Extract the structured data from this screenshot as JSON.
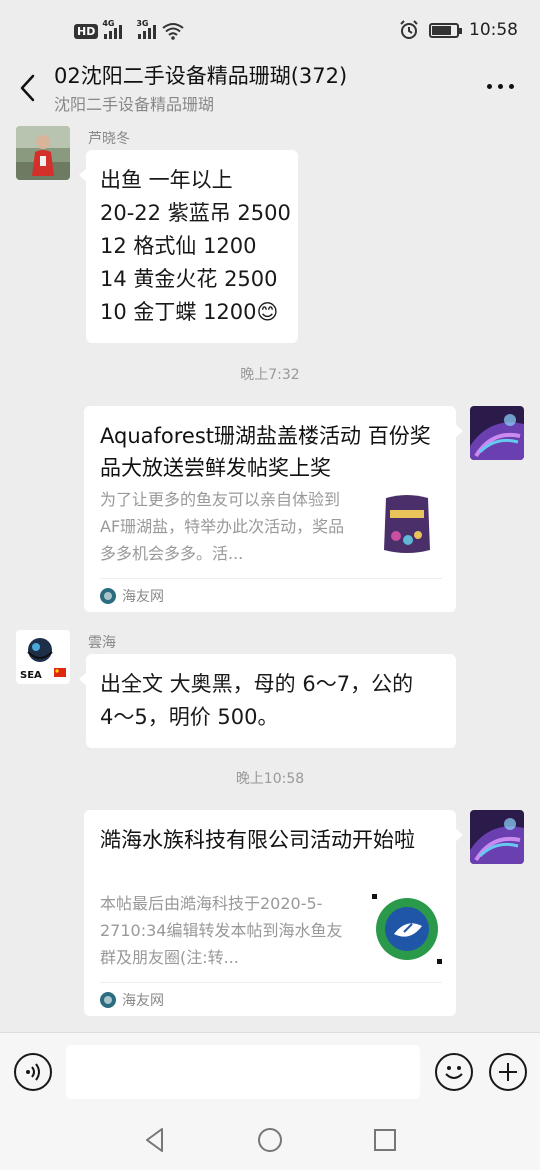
{
  "status_bar": {
    "time": "10:58",
    "hd_label": "HD",
    "sim1_type": "4G",
    "sim2_type": "3G",
    "battery_level": 0.8,
    "icons": [
      "hd-icon",
      "signal-icon",
      "wifi-icon",
      "alarm-icon",
      "battery-icon"
    ]
  },
  "header": {
    "title": "02沈阳二手设备精品珊瑚(372)",
    "subtitle": "沈阳二手设备精品珊瑚"
  },
  "messages": [
    {
      "type": "text",
      "side": "left",
      "sender": "芦晓冬",
      "lines": [
        "出鱼 一年以上",
        "20-22 紫蓝吊 2500",
        "12 格式仙 1200",
        "14 黄金火花 2500",
        "10 金丁蝶 1200😊"
      ]
    },
    {
      "type": "time",
      "text": "晚上7:32"
    },
    {
      "type": "link_card",
      "side": "right",
      "title": "Aquaforest珊湖盐盖楼活动 百份奖品大放送尝鲜发帖奖上奖",
      "description": "为了让更多的鱼友可以亲自体验到AF珊湖盐，特举办此次活动，奖品多多机会多多。活...",
      "source": "海友网"
    },
    {
      "type": "text",
      "side": "left",
      "sender": "雲海",
      "lines": [
        "出全文  大奥黑，母的 6～7，公的",
        "4～5，明价 500。"
      ]
    },
    {
      "type": "time",
      "text": "晚上10:58"
    },
    {
      "type": "link_card",
      "side": "right",
      "title": "澔海水族科技有限公司活动开始啦",
      "description": "本帖最后由澔海科技于2020-5-2710:34编辑转发本帖到海水鱼友群及朋友圈(注:转...",
      "source": "海友网"
    }
  ],
  "input_bar": {
    "text_value": "",
    "icons": [
      "voice-icon",
      "emoji-icon",
      "plus-icon"
    ]
  },
  "nav_bar": {
    "icons": [
      "nav-back-icon",
      "nav-home-icon",
      "nav-recents-icon"
    ]
  },
  "colors": {
    "background": "#ededed",
    "bubble": "#ffffff",
    "meta_text": "#888888",
    "source_icon": "#2b6c7e"
  }
}
